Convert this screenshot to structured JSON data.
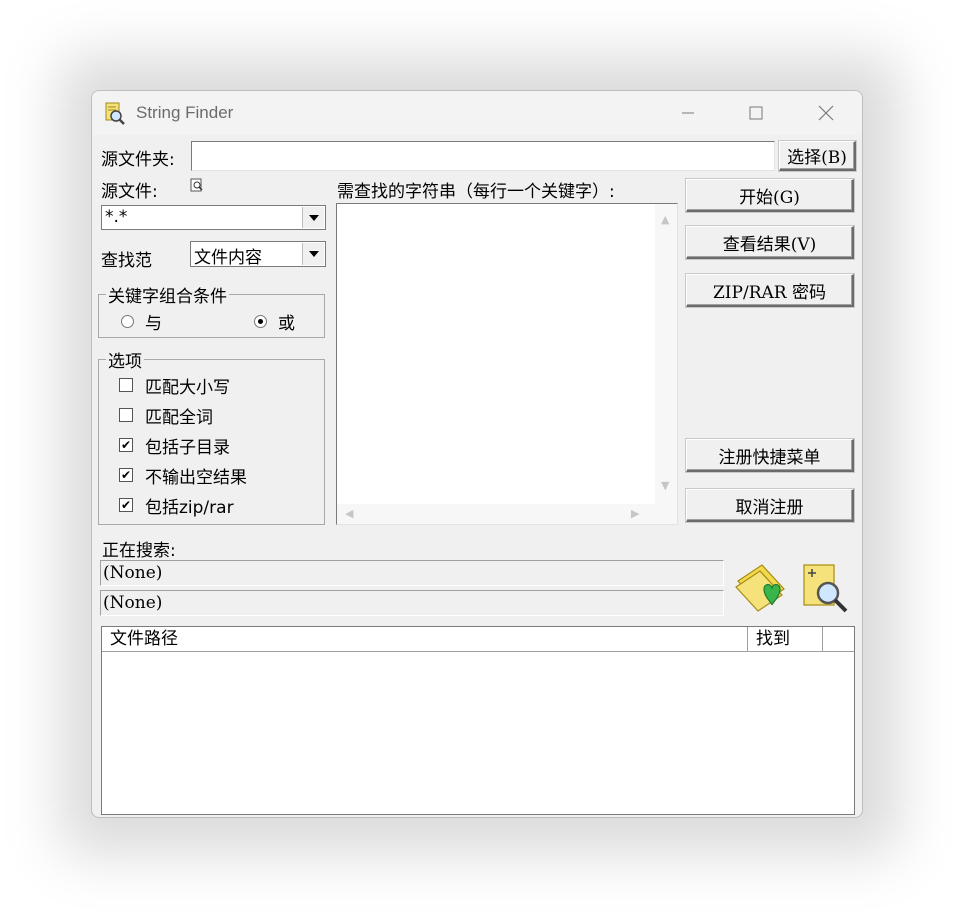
{
  "window": {
    "title": "String Finder"
  },
  "source_folder": {
    "label": "源文件夹:",
    "value": "",
    "browse_label": "选择(B)"
  },
  "source_files": {
    "label": "源文件:",
    "value": "*.*"
  },
  "search_scope": {
    "label": "查找范",
    "value": "文件内容"
  },
  "keyword_group": {
    "title": "关键字组合条件",
    "options": [
      {
        "label": "与",
        "selected": false
      },
      {
        "label": "或",
        "selected": true
      }
    ]
  },
  "options_group": {
    "title": "选项",
    "items": [
      {
        "label": "匹配大小写",
        "checked": false
      },
      {
        "label": "匹配全词",
        "checked": false
      },
      {
        "label": "包括子目录",
        "checked": true
      },
      {
        "label": "不输出空结果",
        "checked": true
      },
      {
        "label": "包括zip/rar",
        "checked": true
      }
    ]
  },
  "keywords": {
    "label": "需查找的字符串（每行一个关键字）:",
    "value": ""
  },
  "buttons": {
    "start": "开始(G)",
    "view_results": "查看结果(V)",
    "zip_password": "ZIP/RAR 密码",
    "register_menu": "注册快捷菜单",
    "unregister": "取消注册"
  },
  "status": {
    "label": "正在搜索:",
    "line1": "(None)",
    "line2": "(None)"
  },
  "results_table": {
    "columns": [
      "文件路径",
      "找到",
      ""
    ],
    "rows": []
  },
  "icons": {
    "app": "find-app-icon",
    "folder_heart": "folder-heart-icon",
    "document_search": "document-search-icon"
  }
}
